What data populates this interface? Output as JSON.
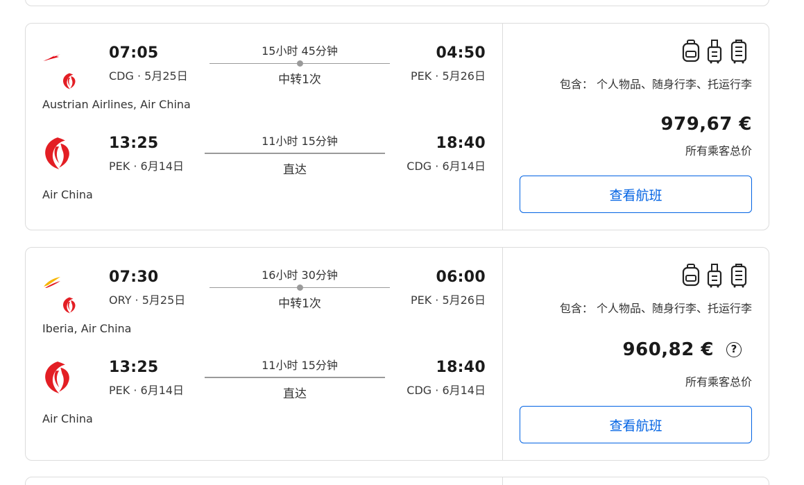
{
  "colors": {
    "accent": "#0062e3",
    "air_china_red": "#e31e24",
    "austrian_red": "#e30613",
    "iberia_yellow": "#f7b600",
    "border": "#dcdcdc"
  },
  "results": [
    {
      "outbound": {
        "logos": [
          "austrian-airlines-logo",
          "air-china-logo"
        ],
        "dep_time": "07:05",
        "dep_place": "CDG · 5月25日",
        "duration": "15小时 45分钟",
        "stops": "中转1次",
        "arr_time": "04:50",
        "arr_place": "PEK · 5月26日",
        "airline": "Austrian Airlines, Air China"
      },
      "inbound": {
        "logos": [
          "air-china-logo"
        ],
        "dep_time": "13:25",
        "dep_place": "PEK · 6月14日",
        "duration": "11小时 15分钟",
        "stops": "直达",
        "arr_time": "18:40",
        "arr_place": "CDG · 6月14日",
        "airline": "Air China"
      },
      "includes": "包含： 个人物品、随身行李、托运行李",
      "price": "979,67 €",
      "price_note": "所有乘客总价",
      "button": "查看航班"
    },
    {
      "outbound": {
        "logos": [
          "iberia-logo",
          "air-china-logo"
        ],
        "dep_time": "07:30",
        "dep_place": "ORY · 5月25日",
        "duration": "16小时 30分钟",
        "stops": "中转1次",
        "arr_time": "06:00",
        "arr_place": "PEK · 5月26日",
        "airline": "Iberia, Air China"
      },
      "inbound": {
        "logos": [
          "air-china-logo"
        ],
        "dep_time": "13:25",
        "dep_place": "PEK · 6月14日",
        "duration": "11小时 15分钟",
        "stops": "直达",
        "arr_time": "18:40",
        "arr_place": "CDG · 6月14日",
        "airline": "Air China"
      },
      "includes": "包含： 个人物品、随身行李、托运行李",
      "price": "960,82 €",
      "help_icon": "?",
      "price_note": "所有乘客总价",
      "button": "查看航班"
    }
  ]
}
